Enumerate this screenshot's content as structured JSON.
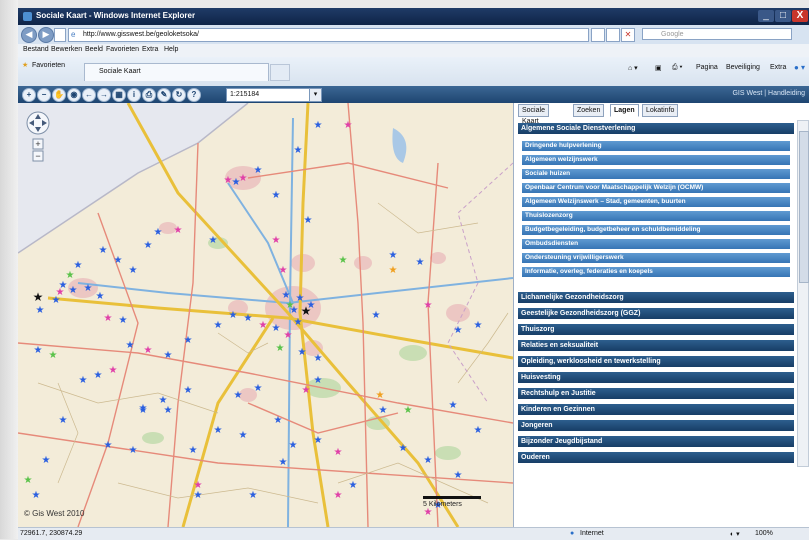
{
  "window": {
    "title": "Sociale Kaart - Windows Internet Explorer",
    "min": "_",
    "max": "□",
    "close": "X"
  },
  "address": {
    "url": "http://www.gisswest.be/geoloketsoka/",
    "search_placeholder": "Google"
  },
  "menu": [
    "Bestand",
    "Bewerken",
    "Beeld",
    "Favorieten",
    "Extra",
    "Help"
  ],
  "favorites": {
    "label": "Favorieten",
    "tab": "Sociale Kaart"
  },
  "commandbar": {
    "page": "Pagina",
    "security": "Beveiliging",
    "extra": "Extra"
  },
  "app_toolbar": {
    "scale": "1:215184",
    "link": "GIS West | Handleiding"
  },
  "map": {
    "copyright": "© Gis West 2010",
    "scale_label": "5 Kilometers"
  },
  "panel": {
    "tabs": [
      "Sociale Kaart",
      "Zoeken",
      "Lagen",
      "Lokatinfo"
    ],
    "active_tab": "Lagen",
    "top_section": "Algemene Sociale Dienstverlening",
    "subitems": [
      "Dringende hulpverlening",
      "Algemeen welzijnswerk",
      "Sociale huizen",
      "Openbaar Centrum voor Maatschappelijk Welzijn (OCMW)",
      "Algemeen Welzijnswerk – Stad, gemeenten, buurten",
      "Thuislozenzorg",
      "Budgetbegeleiding, budgetbeheer en schuldbemiddeling",
      "Ombudsdiensten",
      "Ondersteuning vrijwilligerswerk",
      "Informatie, overleg, federaties en koepels"
    ],
    "sections": [
      "Lichamelijke Gezondheidszorg",
      "Geestelijke Gezondheidszorg (GGZ)",
      "Thuiszorg",
      "Relaties en seksualiteit",
      "Opleiding, werkloosheid en tewerkstelling",
      "Huisvesting",
      "Rechtshulp en Justitie",
      "Kinderen en Gezinnen",
      "Jongeren",
      "Bijzonder Jeugdbijstand",
      "Ouderen"
    ]
  },
  "status": {
    "coords": "72961.7, 230874.29",
    "zone": "Internet",
    "zoom": "100%"
  },
  "colors": {
    "marker_blue": "#2a5fe0",
    "marker_pink": "#e040a8",
    "marker_green": "#5ac24a",
    "marker_orange": "#f0a020",
    "marker_black": "#111111"
  }
}
